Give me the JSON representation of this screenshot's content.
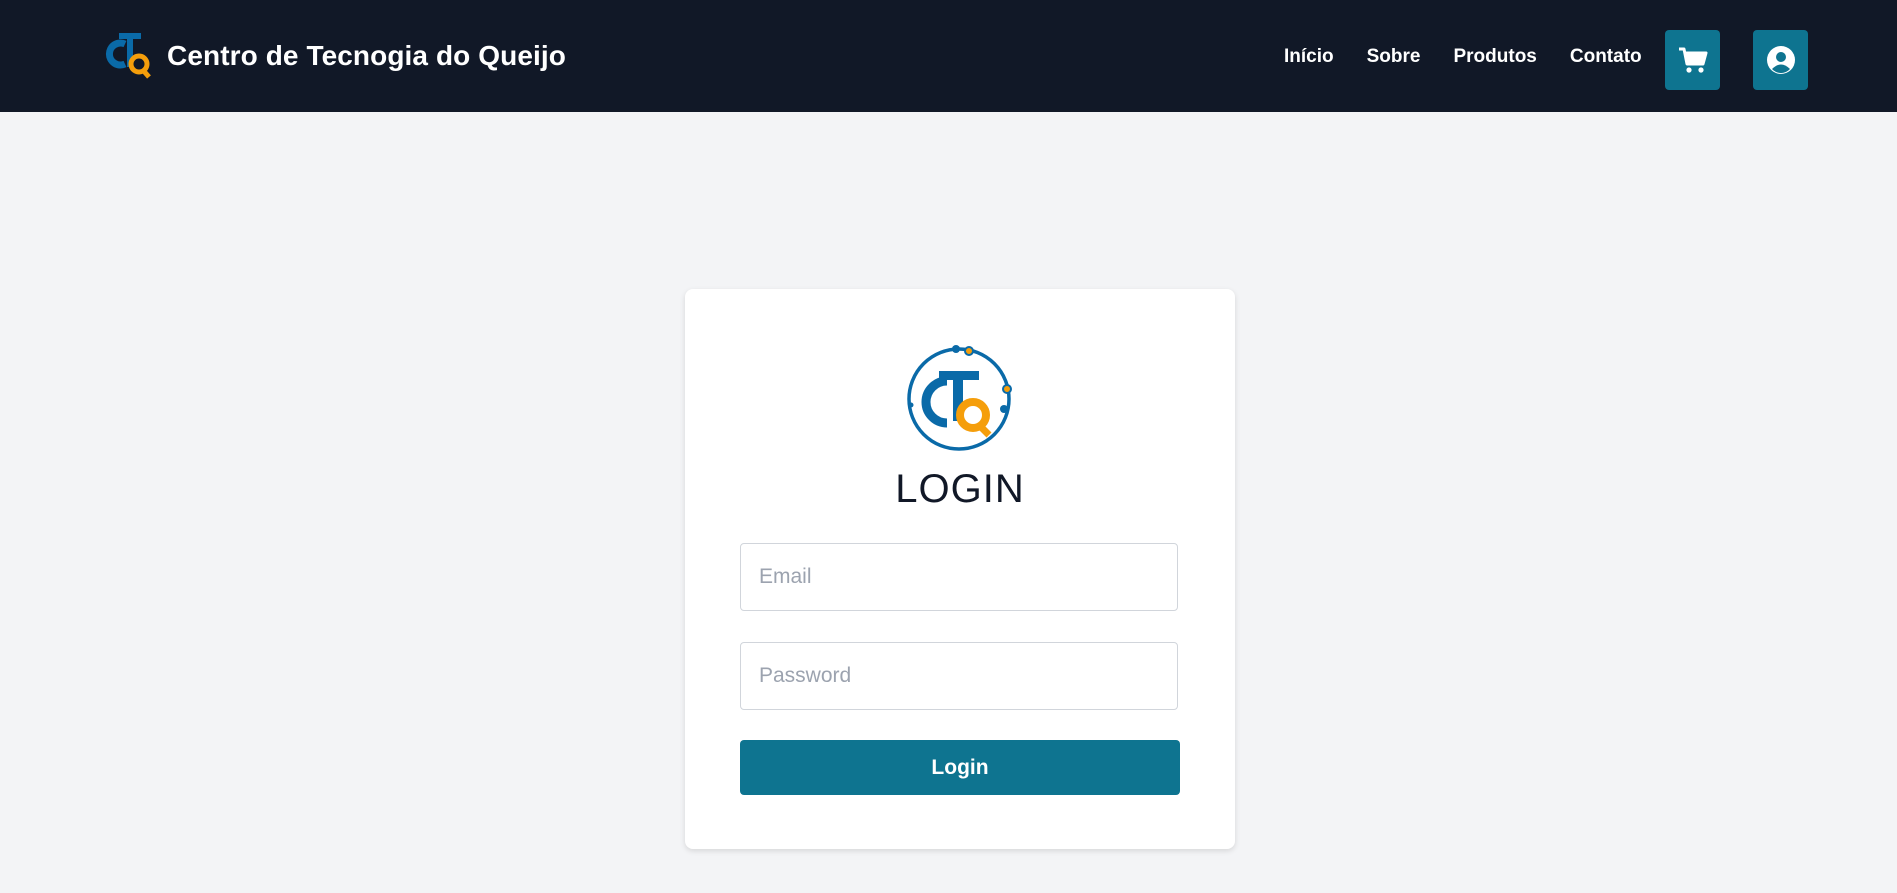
{
  "header": {
    "brand_name": "Centro de Tecnogia do Queijo",
    "logo_icon": "ctq-logo-icon",
    "nav": [
      {
        "label": "Início"
      },
      {
        "label": "Sobre"
      },
      {
        "label": "Produtos"
      },
      {
        "label": "Contato"
      }
    ],
    "cart_icon": "shopping-cart-icon",
    "user_icon": "user-circle-icon"
  },
  "login": {
    "title": "LOGIN",
    "email_placeholder": "Email",
    "password_placeholder": "Password",
    "submit_label": "Login"
  },
  "colors": {
    "header_bg": "#111827",
    "accent": "#0e7490",
    "page_bg": "#f3f4f6",
    "logo_blue": "#0a6aa8",
    "logo_orange": "#f59e0b"
  }
}
